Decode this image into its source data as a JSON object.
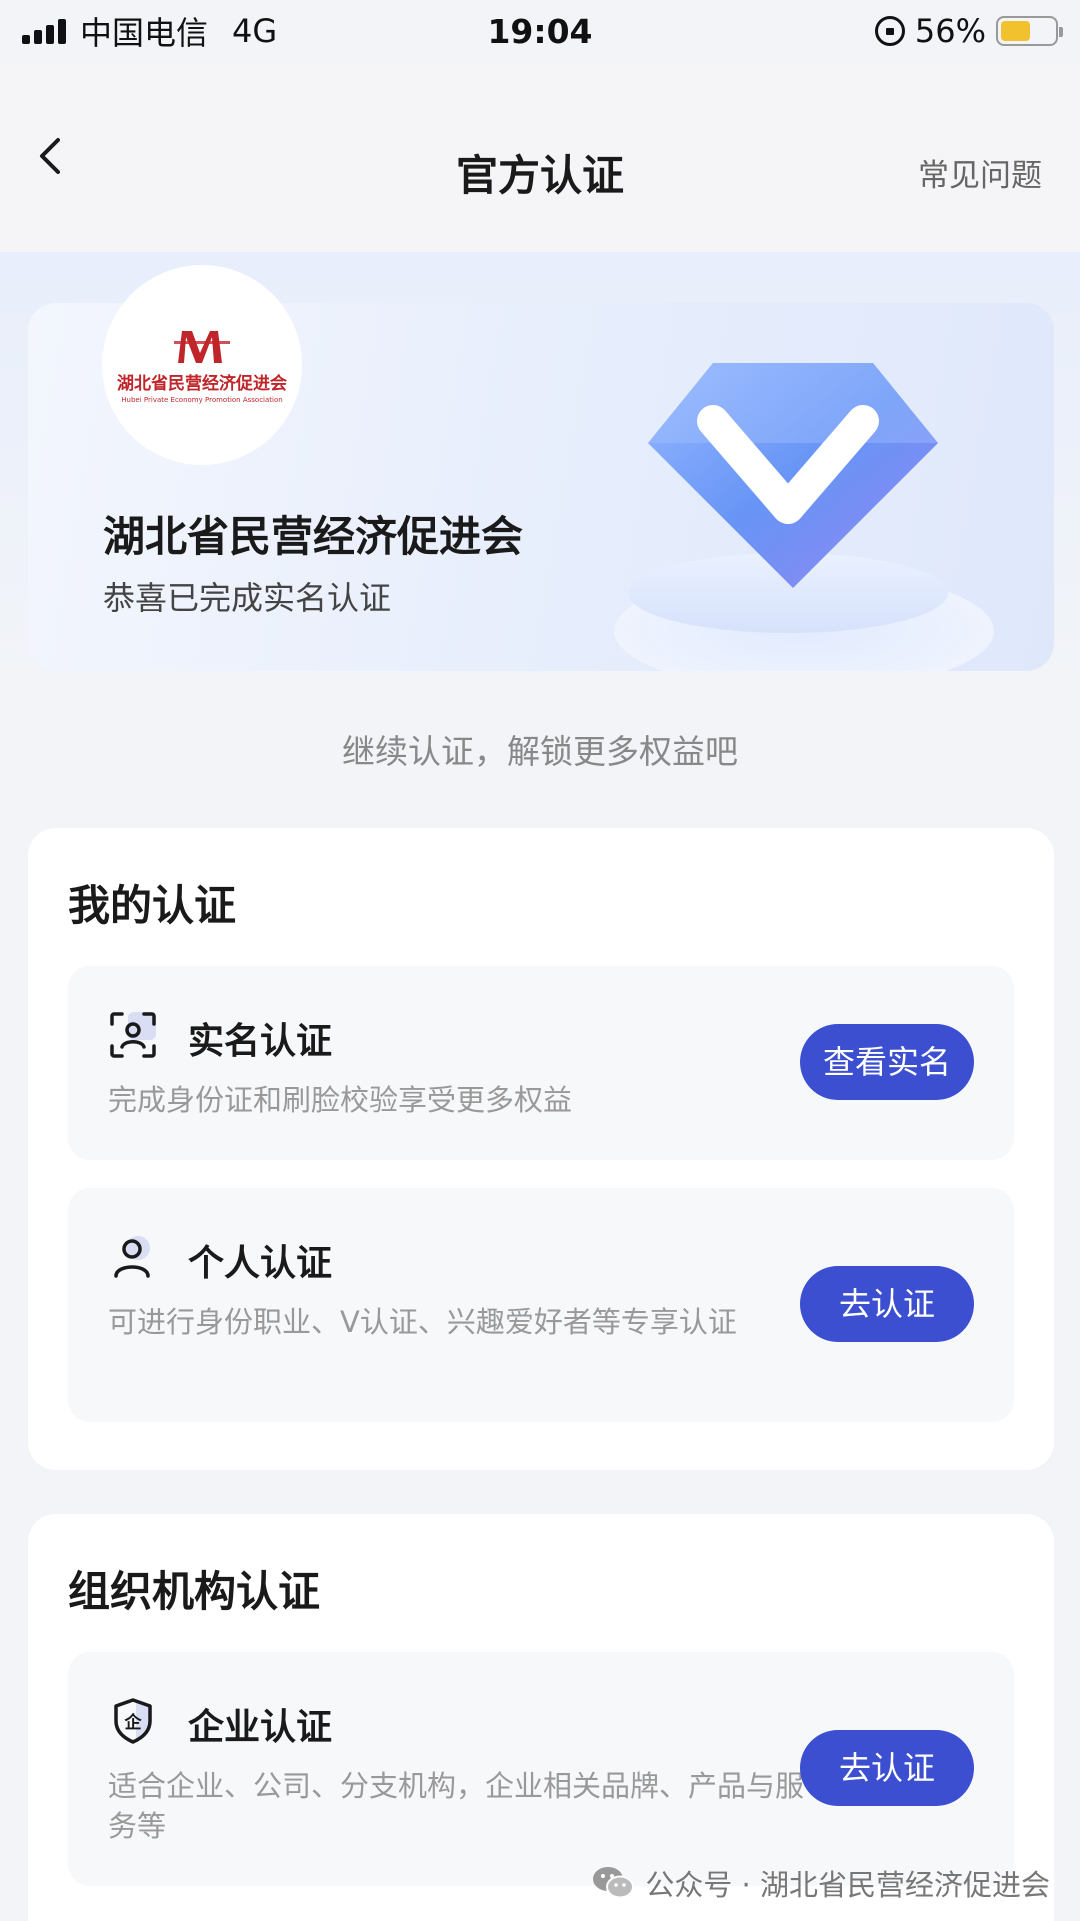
{
  "status_bar": {
    "carrier": "中国电信",
    "network": "4G",
    "time": "19:04",
    "battery_percent": "56%",
    "battery_level": 0.56
  },
  "nav": {
    "title": "官方认证",
    "faq": "常见问题"
  },
  "hero": {
    "logo_text_cn": "湖北省民营经济促进会",
    "logo_text_en": "Hubei Private Economy Promotion Association",
    "org_name": "湖北省民营经济促进会",
    "verified_text": "恭喜已完成实名认证"
  },
  "continue_tip": "继续认证，解锁更多权益吧",
  "my_cert": {
    "title": "我的认证",
    "items": [
      {
        "title": "实名认证",
        "desc": "完成身份证和刷脸校验享受更多权益",
        "button": "查看实名",
        "icon": "face-scan-icon"
      },
      {
        "title": "个人认证",
        "desc": "可进行身份职业、V认证、兴趣爱好者等专享认证",
        "button": "去认证",
        "icon": "person-icon"
      }
    ]
  },
  "org_cert": {
    "title": "组织机构认证",
    "items": [
      {
        "title": "企业认证",
        "desc": "适合企业、公司、分支机构，企业相关品牌、产品与服务等",
        "button": "去认证",
        "icon": "enterprise-shield-icon"
      }
    ]
  },
  "watermark": "公众号 · 湖北省民营经济促进会",
  "colors": {
    "button": "#3b4fd0",
    "battery": "#f2c12e",
    "logo_red": "#c0252a"
  }
}
